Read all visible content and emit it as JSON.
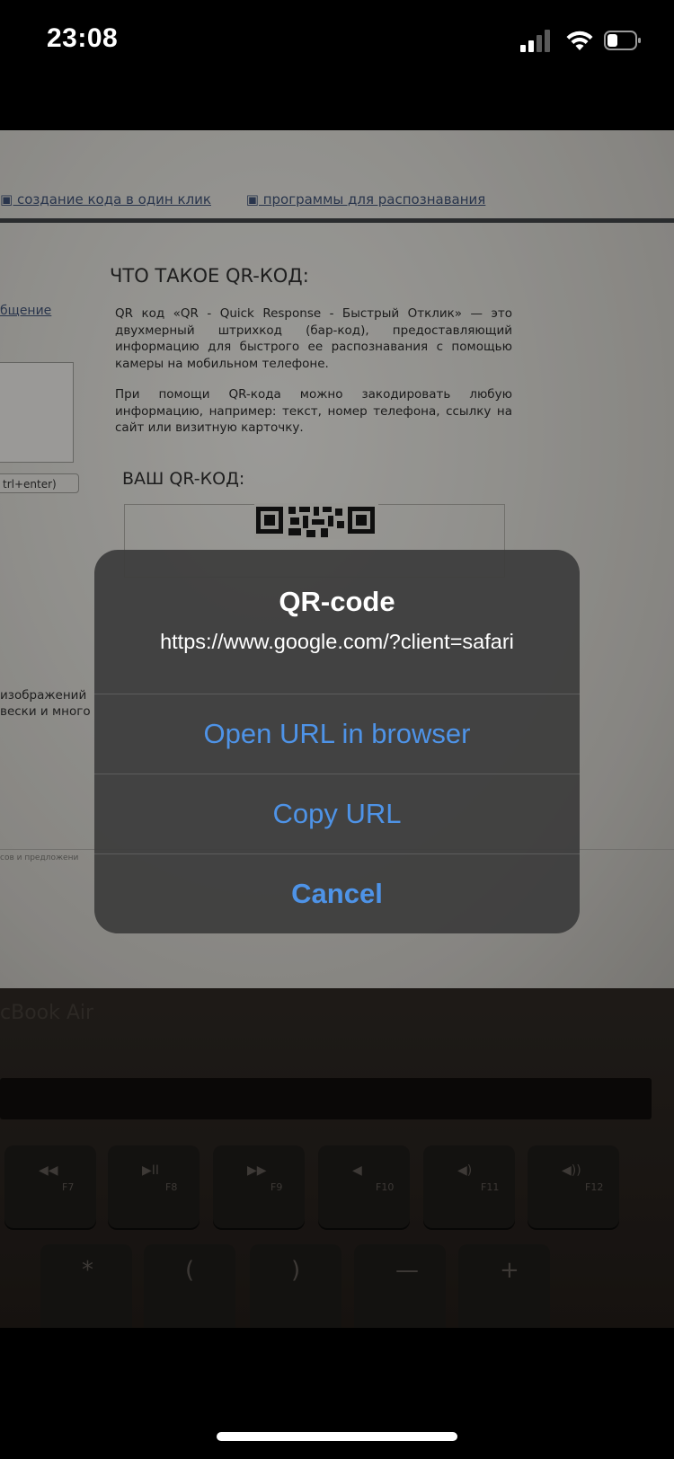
{
  "status_bar": {
    "time": "23:08"
  },
  "background_photo": {
    "links": [
      "▣ создание кода в один клик",
      "▣ программы для распознавания"
    ],
    "heading": "ЧТО ТАКОЕ QR-КОД:",
    "paragraph1": "QR код «QR - Quick Response - Быстрый Отклик» — это двухмерный штрихкод (бар-код), предоставляющий информацию для быстрого ее распознавания с помощью камеры на мобильном телефоне.",
    "paragraph2": "При помощи QR-кода можно закодировать любую информацию, например: текст, номер телефона, ссылку на сайт или визитную карточку.",
    "heading2": "ВАШ QR-КОД:",
    "left_link": "бщение",
    "left_button": "trl+enter)",
    "left_text_line1": "изображений",
    "left_text_line2": "вески и много",
    "footer_text": "сов и предложени",
    "laptop_label": "cBook Air",
    "keys": [
      {
        "symbol": "◀◀",
        "fn": "F7"
      },
      {
        "symbol": "▶II",
        "fn": "F8"
      },
      {
        "symbol": "▶▶",
        "fn": "F9"
      },
      {
        "symbol": "◀",
        "fn": "F10"
      },
      {
        "symbol": "◀)",
        "fn": "F11"
      },
      {
        "symbol": "◀))",
        "fn": "F12"
      }
    ],
    "number_keys": [
      "*",
      "(",
      ")",
      "—",
      "+"
    ]
  },
  "alert": {
    "title": "QR-code",
    "message": "https://www.google.com/?client=safari",
    "buttons": {
      "open": "Open URL in browser",
      "copy": "Copy URL",
      "cancel": "Cancel"
    },
    "accent_color": "#4e93e7"
  }
}
